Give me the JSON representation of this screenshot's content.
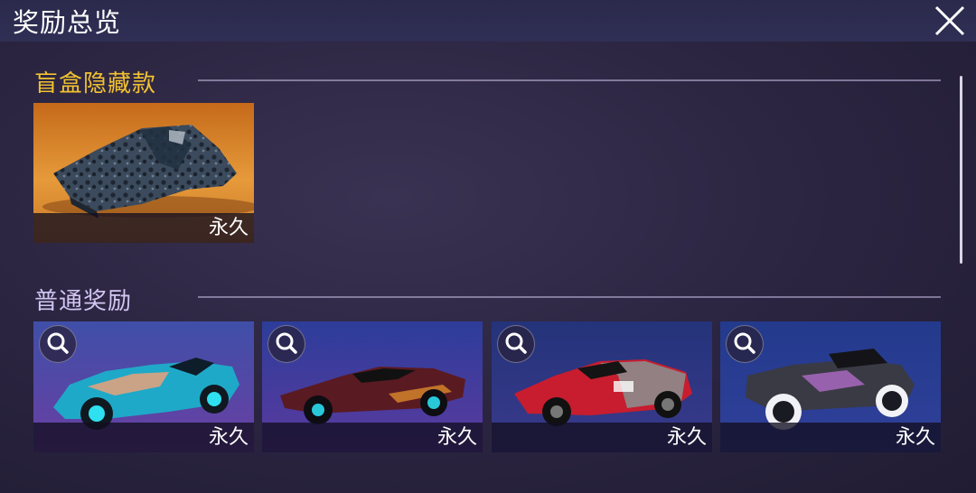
{
  "header": {
    "title": "奖励总览",
    "close_icon": "close-icon"
  },
  "sections": [
    {
      "title": "盲盒隐藏款",
      "title_color": "#f2c230",
      "items": [
        {
          "name": "盲盒隐藏款",
          "duration": "永久"
        }
      ]
    },
    {
      "title": "普通奖励",
      "title_color": "#d3c6f2",
      "items": [
        {
          "duration": "永久",
          "zoom_icon": "magnifier-icon"
        },
        {
          "duration": "永久",
          "zoom_icon": "magnifier-icon"
        },
        {
          "duration": "永久",
          "zoom_icon": "magnifier-icon"
        },
        {
          "duration": "永久",
          "zoom_icon": "magnifier-icon"
        }
      ]
    }
  ]
}
